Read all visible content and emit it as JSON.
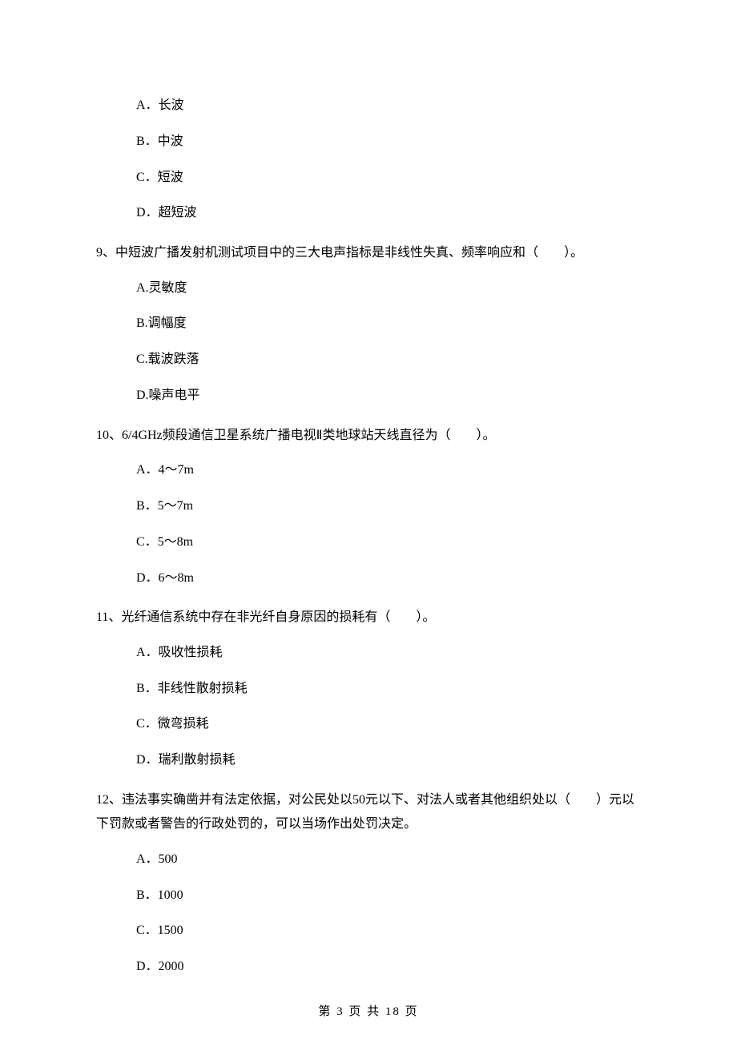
{
  "q8": {
    "options": {
      "A": "A．长波",
      "B": "B．中波",
      "C": "C．短波",
      "D": "D．超短波"
    }
  },
  "q9": {
    "stem": "9、中短波广播发射机测试项目中的三大电声指标是非线性失真、频率响应和（　　）。",
    "options": {
      "A": "A.灵敏度",
      "B": "B.调幅度",
      "C": "C.载波跌落",
      "D": "D.噪声电平"
    }
  },
  "q10": {
    "stem": "10、6/4GHz频段通信卫星系统广播电视Ⅱ类地球站天线直径为（　　）。",
    "options": {
      "A": "A．4～7m",
      "B": "B．5～7m",
      "C": "C．5～8m",
      "D": "D．6～8m"
    }
  },
  "q11": {
    "stem": "11、光纤通信系统中存在非光纤自身原因的损耗有（　　）。",
    "options": {
      "A": "A．吸收性损耗",
      "B": "B．非线性散射损耗",
      "C": "C．微弯损耗",
      "D": "D．瑞利散射损耗"
    }
  },
  "q12": {
    "stem": "12、违法事实确凿并有法定依据，对公民处以50元以下、对法人或者其他组织处以（　　）元以下罚款或者警告的行政处罚的，可以当场作出处罚决定。",
    "options": {
      "A": "A．500",
      "B": "B．1000",
      "C": "C．1500",
      "D": "D．2000"
    }
  },
  "footer": "第 3 页 共 18 页"
}
